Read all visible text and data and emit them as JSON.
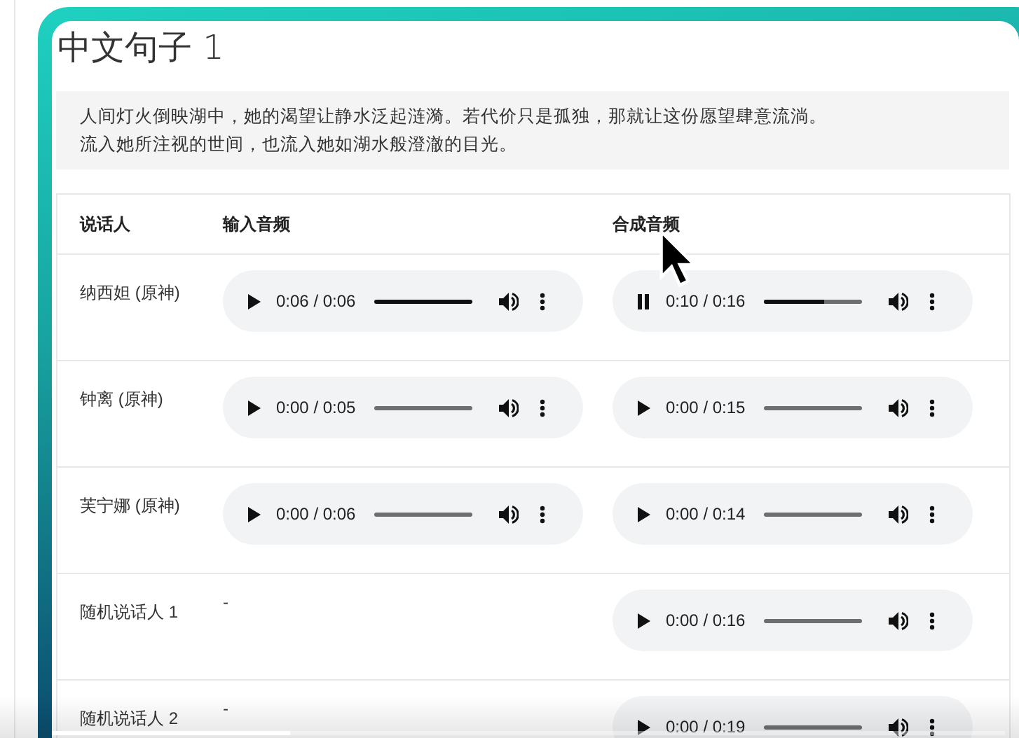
{
  "title": "中文句子 1",
  "sentence_lines": [
    "人间灯火倒映湖中，她的渴望让静水泛起涟漪。若代价只是孤独，那就让这份愿望肆意流淌。",
    "流入她所注视的世间，也流入她如湖水般澄澈的目光。"
  ],
  "table": {
    "columns": [
      "说话人",
      "输入音频",
      "合成音频"
    ],
    "rows": [
      {
        "speaker": "纳西妲 (原神)",
        "input": {
          "kind": "audio",
          "playing": false,
          "time": "0:06 / 0:06",
          "level": 1
        },
        "output": {
          "kind": "audio",
          "playing": true,
          "time": "0:10 / 0:16",
          "level": 0.62
        }
      },
      {
        "speaker": "钟离 (原神)",
        "input": {
          "kind": "audio",
          "playing": false,
          "time": "0:00 / 0:05",
          "level": 0
        },
        "output": {
          "kind": "audio",
          "playing": false,
          "time": "0:00 / 0:15",
          "level": 0
        }
      },
      {
        "speaker": "芙宁娜 (原神)",
        "input": {
          "kind": "audio",
          "playing": false,
          "time": "0:00 / 0:06",
          "level": 0
        },
        "output": {
          "kind": "audio",
          "playing": false,
          "time": "0:00 / 0:14",
          "level": 0
        }
      },
      {
        "speaker": "随机说话人 1",
        "input": {
          "kind": "none",
          "text": "-"
        },
        "output": {
          "kind": "audio",
          "playing": false,
          "time": "0:00 / 0:16",
          "level": 0
        }
      },
      {
        "speaker": "随机说话人 2",
        "input": {
          "kind": "none",
          "text": "-"
        },
        "output": {
          "kind": "audio",
          "playing": false,
          "time": "0:00 / 0:19",
          "level": 0
        }
      }
    ]
  },
  "video_progress": {
    "level": 0.25
  }
}
